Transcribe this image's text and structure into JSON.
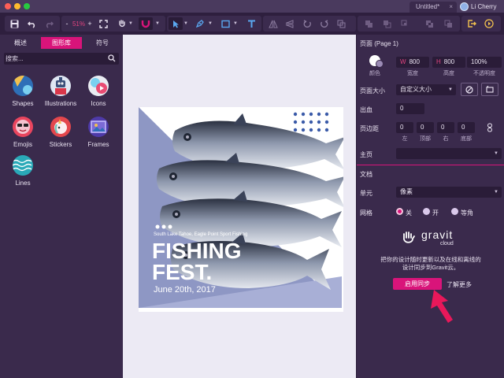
{
  "window": {
    "tab_title": "Untitled*",
    "tab_close": "×",
    "user_name": "Li Cherry"
  },
  "toolbar": {
    "zoom_label": "51%",
    "zoom_minus": "-",
    "zoom_plus": "+"
  },
  "left_panel": {
    "tabs": [
      "概述",
      "图形库",
      "符号"
    ],
    "active_tab_index": 1,
    "search_placeholder": "搜索...",
    "libraries": [
      "Shapes",
      "Illustrations",
      "Icons",
      "Emojis",
      "Stickers",
      "Frames",
      "Lines"
    ]
  },
  "artwork": {
    "subtitle": "South Lake Tahoe, Eagle Point Sport Fishing",
    "title_line1": "FISHING",
    "title_line2": "FEST.",
    "date": "June 20th, 2017"
  },
  "right_panel": {
    "page_header": "页面 (Page 1)",
    "color_label": "颜色",
    "width_prefix": "W",
    "width_value": "800",
    "width_label": "宽度",
    "height_prefix": "H",
    "height_value": "800",
    "height_label": "高度",
    "opacity_value": "100%",
    "opacity_label": "不透明度",
    "page_size_label": "页面大小",
    "page_size_value": "自定义大小",
    "bleed_label": "出血",
    "bleed_value": "0",
    "margins_label": "页边距",
    "margin_values": [
      "0",
      "0",
      "0",
      "0"
    ],
    "margin_labels": [
      "左",
      "顶部",
      "右",
      "底部"
    ],
    "master_label": "主页",
    "document_header": "文档",
    "unit_label": "单元",
    "unit_value": "像素",
    "grid_label": "网格",
    "grid_options": [
      "关",
      "开",
      "等角"
    ],
    "grid_selected": 0,
    "brand_name": "gravit",
    "brand_sub": "cloud",
    "sync_text_line1": "把你的设计随时更新以及在线和离线的",
    "sync_text_line2": "设计同步到Gravit云。",
    "sync_button": "启用同步",
    "learn_more": "了解更多"
  },
  "colors": {
    "accent": "#d9147a",
    "panel_bg": "#3a2a4c",
    "toolbar_bg": "#2e1f3e",
    "canvas_bg": "#eceaf4",
    "annotation_arrow": "#e8185a"
  }
}
